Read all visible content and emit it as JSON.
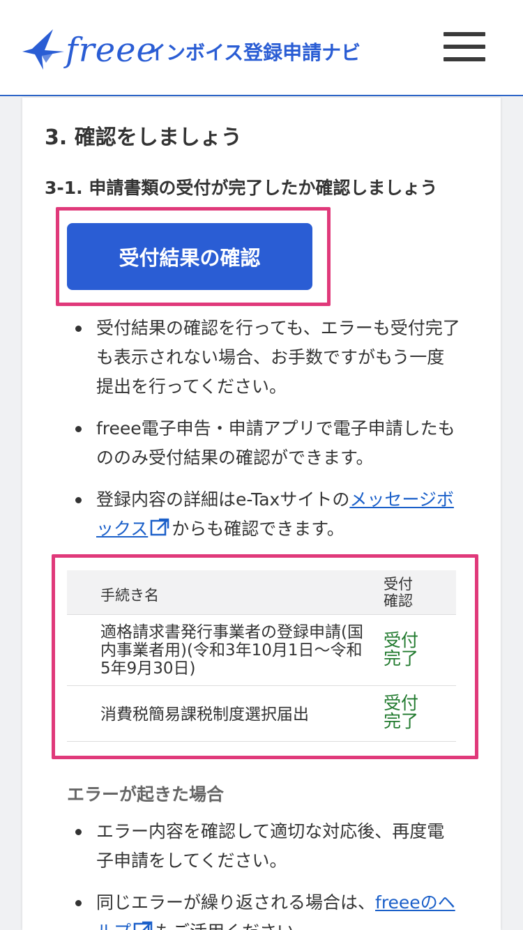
{
  "header": {
    "logo_word": "freee",
    "logo_sub": "インボイス登録申請ナビ"
  },
  "section": {
    "title": "3. 確認をしましょう",
    "subtitle": "3-1. 申請書類の受付が完了したか確認しましょう",
    "button_label": "受付結果の確認"
  },
  "bullets": {
    "b1": "受付結果の確認を行っても、エラーも受付完了も表示されない場合、お手数ですがもう一度提出を行ってください。",
    "b2": "freee電子申告・申請アプリで電子申請したもののみ受付結果の確認ができます。",
    "b3_pre": "登録内容の詳細はe-Taxサイトの",
    "b3_link": "メッセージボックス",
    "b3_post": "からも確認できます。"
  },
  "table": {
    "col_name": "手続き名",
    "col_status": "受付確認",
    "rows": [
      {
        "name": "適格請求書発行事業者の登録申請(国内事業者用)(令和3年10月1日〜令和5年9月30日)",
        "status": "受付完了"
      },
      {
        "name": "消費税簡易課税制度選択届出",
        "status": "受付完了"
      }
    ]
  },
  "error": {
    "heading": "エラーが起きた場合",
    "b1": "エラー内容を確認して適切な対応後、再度電子申請をしてください。",
    "b2_pre": "同じエラーが繰り返される場合は、",
    "b2_link": "freeeのヘルプ",
    "b2_post": "もご活用ください。"
  },
  "colors": {
    "brand": "#2a5dd4",
    "highlight": "#e0397a",
    "success": "#217a2e"
  }
}
